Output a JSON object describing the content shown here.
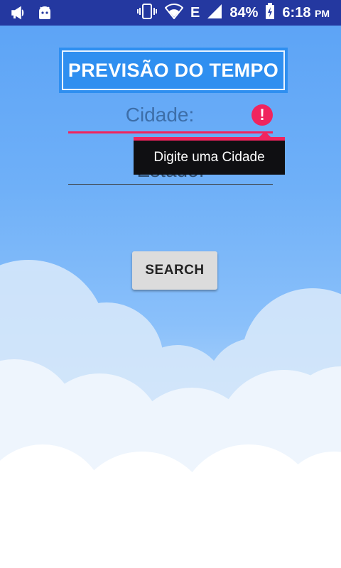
{
  "status_bar": {
    "battery": "84%",
    "network": "E",
    "time": "6:18",
    "ampm": "PM",
    "icons": [
      "megaphone-icon",
      "android-icon",
      "vibrate-icon",
      "wifi-icon",
      "signal-icon",
      "battery-charging-icon"
    ],
    "background": "#2438a0"
  },
  "header": {
    "title": "PREVISÃO DO TEMPO"
  },
  "form": {
    "city_placeholder": "Cidade:",
    "state_placeholder": "Estado:",
    "error_tooltip": "Digite uma Cidade",
    "error_symbol": "!",
    "error_color": "#f0245e"
  },
  "actions": {
    "search_label": "SEARCH"
  }
}
